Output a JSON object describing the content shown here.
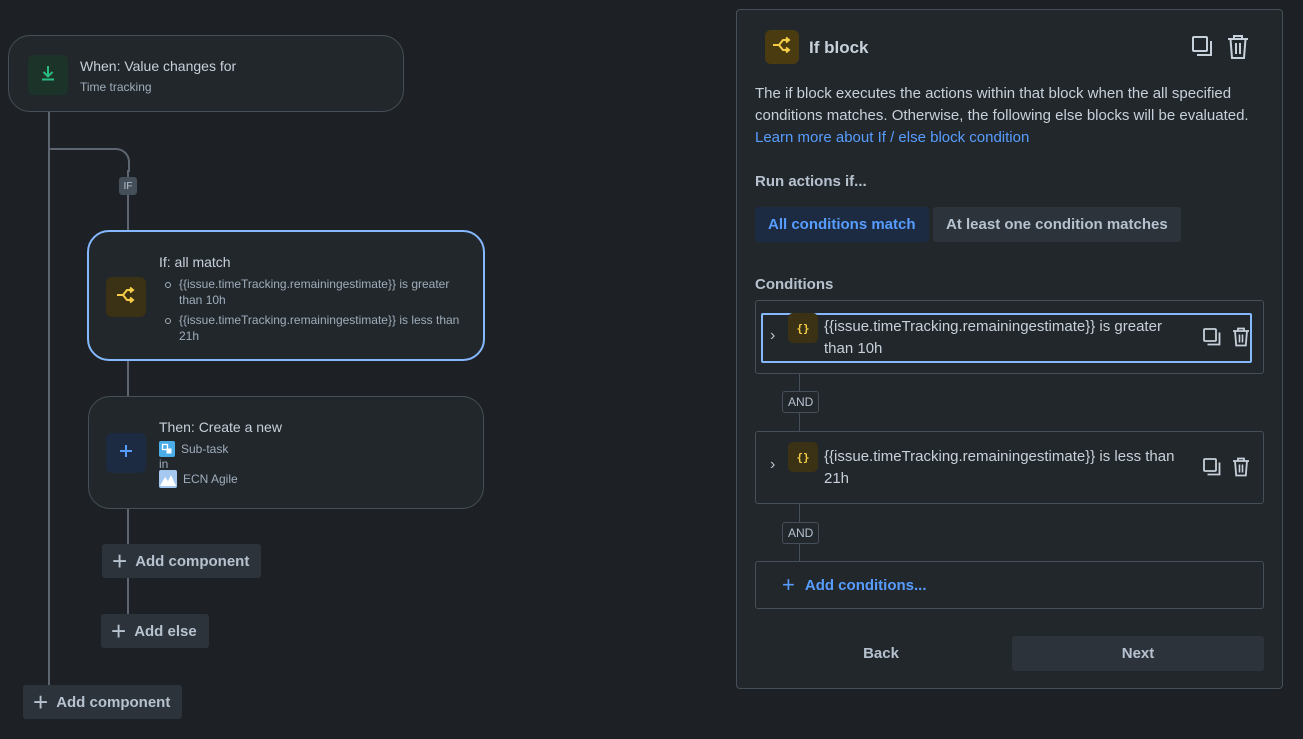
{
  "trigger": {
    "title": "When: Value changes for",
    "subtitle": "Time tracking"
  },
  "branch_tag": "IF",
  "if_card": {
    "title": "If: all match",
    "conditions": [
      "{{issue.timeTracking.remainingestimate}} is greater than 10h",
      "{{issue.timeTracking.remainingestimate}} is less than 21h"
    ]
  },
  "then_card": {
    "title": "Then: Create a new",
    "issue_type": "Sub-task",
    "in_label": "in",
    "project": "ECN Agile"
  },
  "canvas_buttons": {
    "add_component_inner": "Add component",
    "add_else": "Add else",
    "add_component_outer": "Add component"
  },
  "panel": {
    "title": "If block",
    "description": "The if block executes the actions within that block when the all specified conditions matches. Otherwise, the following else blocks will be evaluated.",
    "learn_more": "Learn more about If / else block condition",
    "run_label": "Run actions if...",
    "option_all": "All conditions match",
    "option_any": "At least one condition matches",
    "conditions_label": "Conditions",
    "conditions": [
      "{{issue.timeTracking.remainingestimate}} is greater than 10h",
      "{{issue.timeTracking.remainingestimate}} is less than 21h"
    ],
    "condition_icon": "{}",
    "and_label": "AND",
    "add_conditions": "Add conditions...",
    "back": "Back",
    "next": "Next"
  },
  "colors": {
    "background": "#1d2125",
    "accent_blue": "#579dff",
    "selected_border": "#85b8ff",
    "trigger_green": "#2abb7f",
    "branch_yellow": "#f5cd47"
  }
}
